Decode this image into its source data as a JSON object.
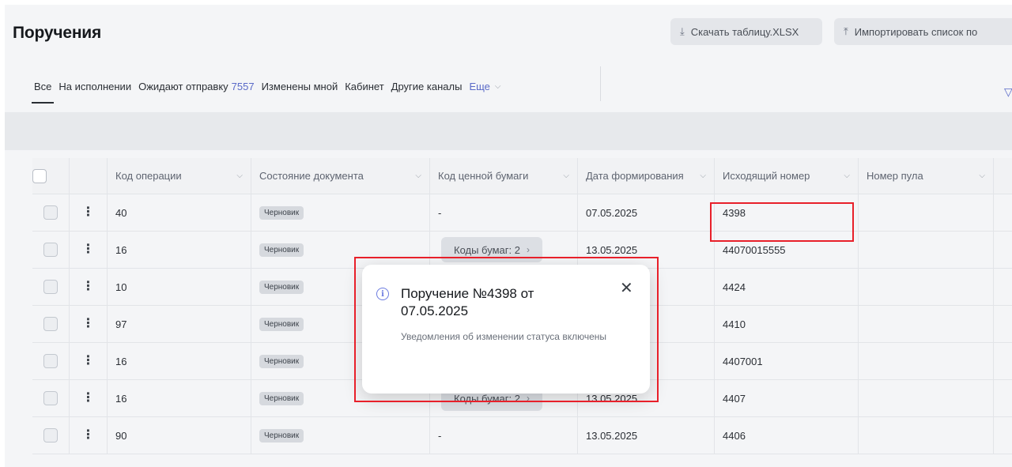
{
  "header": {
    "title": "Поручения",
    "download_label": "Скачать таблицу.XLSX",
    "import_label": "Импортировать список по"
  },
  "tabs": [
    {
      "label": "Все",
      "active": true
    },
    {
      "label": "На исполнении"
    },
    {
      "label": "Ожидают отправку",
      "count": "7557"
    },
    {
      "label": "Изменены мной"
    },
    {
      "label": "Кабинет"
    },
    {
      "label": "Другие каналы"
    }
  ],
  "tabs_more": "Еще",
  "table": {
    "columns": [
      "Код операции",
      "Состояние документа",
      "Код ценной бумаги",
      "Дата формирования",
      "Исходящий номер",
      "Номер пула"
    ],
    "rows": [
      {
        "op": "40",
        "state": "Черновик",
        "security": "-",
        "date": "07.05.2025",
        "out": "4398",
        "pool": ""
      },
      {
        "op": "16",
        "state": "Черновик",
        "security": "Коды бумаг: 2",
        "date": "13.05.2025",
        "out": "44070015555",
        "pool": ""
      },
      {
        "op": "10",
        "state": "Черновик",
        "security": "",
        "date": "",
        "out": "4424",
        "pool": ""
      },
      {
        "op": "97",
        "state": "Черновик",
        "security": "",
        "date": "",
        "out": "4410",
        "pool": ""
      },
      {
        "op": "16",
        "state": "Черновик",
        "security": "",
        "date": "",
        "out": "4407001",
        "pool": ""
      },
      {
        "op": "16",
        "state": "Черновик",
        "security": "Коды бумаг: 2",
        "date": "13.05.2025",
        "out": "4407",
        "pool": ""
      },
      {
        "op": "90",
        "state": "Черновик",
        "security": "-",
        "date": "13.05.2025",
        "out": "4406",
        "pool": ""
      }
    ]
  },
  "modal": {
    "title": "Поручение №4398 от 07.05.2025",
    "description": "Уведомления об изменении статуса включены"
  },
  "colors": {
    "accent": "#5a6ac8",
    "highlight": "#e8202a"
  },
  "icons": [
    "download-icon",
    "upload-icon",
    "filter-icon",
    "info-icon",
    "close-icon",
    "kebab-menu-icon",
    "chevron-down-icon",
    "chevron-right-icon"
  ]
}
